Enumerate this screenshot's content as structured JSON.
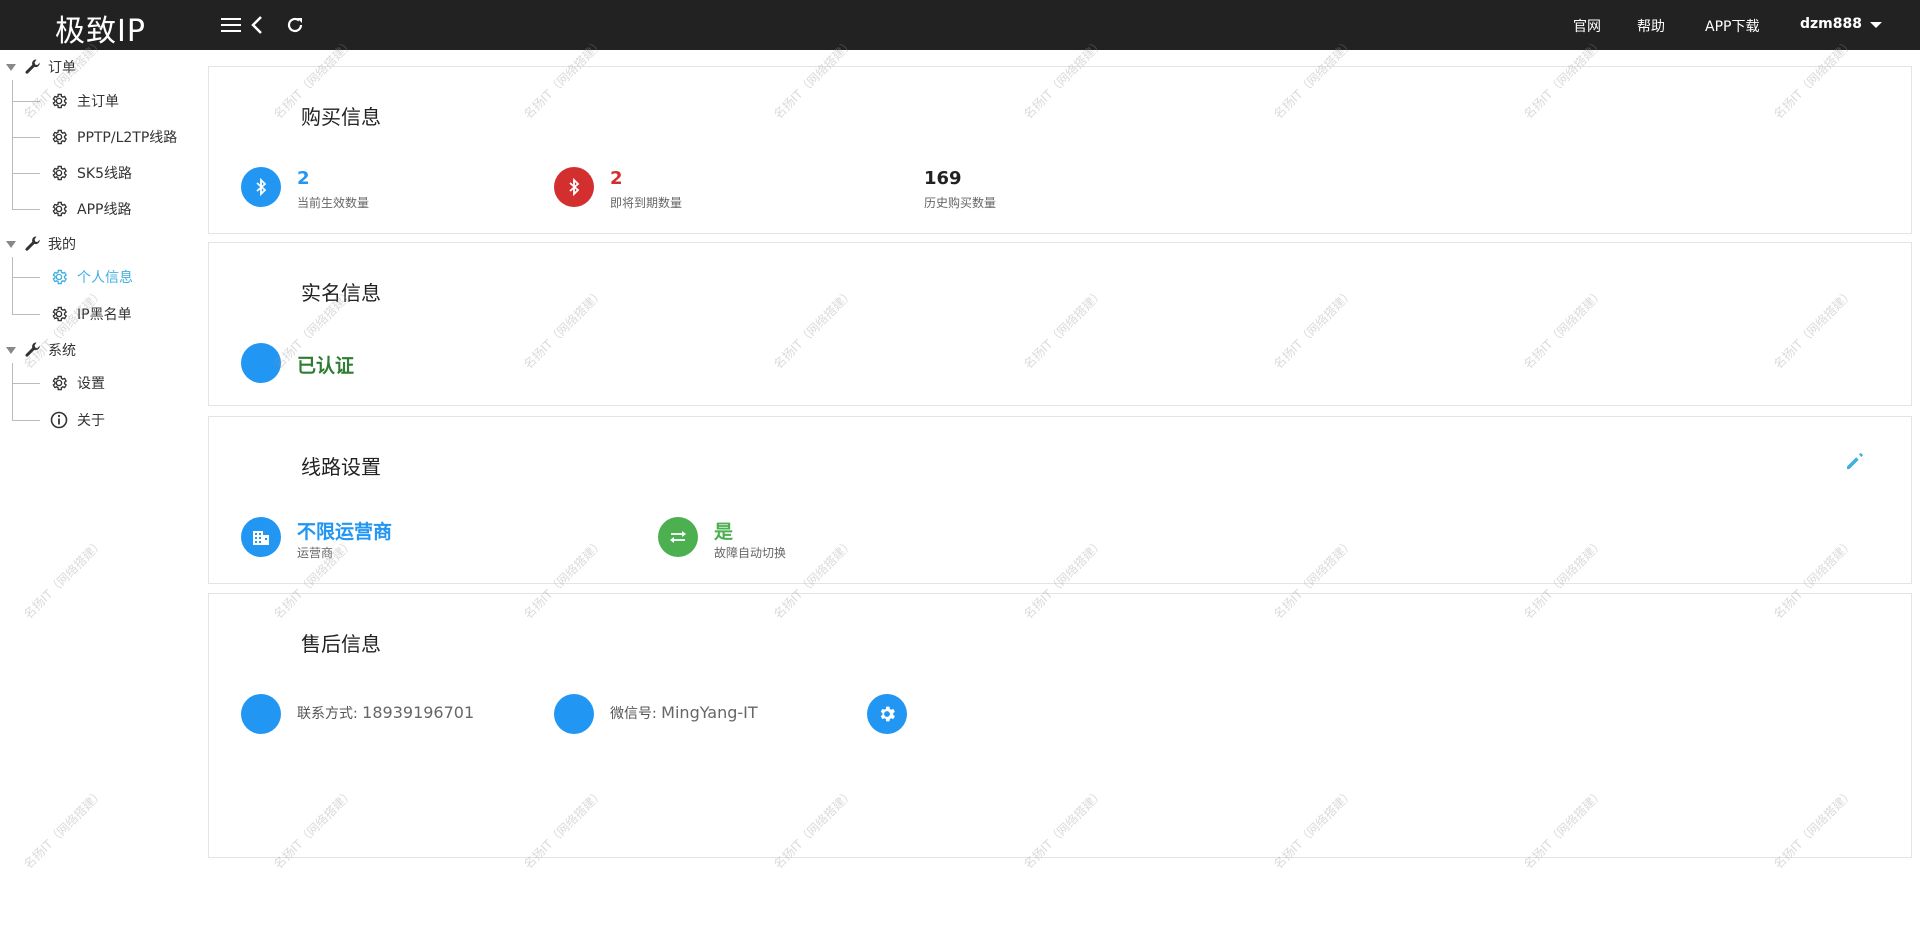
{
  "app": {
    "brand": "极致IP"
  },
  "topbar": {
    "nav": [
      "官网",
      "帮助",
      "APP下载"
    ],
    "user": "dzm888"
  },
  "sidebar": {
    "groups": [
      {
        "label": "订单",
        "items": [
          "主订单",
          "PPTP/L2TP线路",
          "SK5线路",
          "APP线路"
        ]
      },
      {
        "label": "我的",
        "items": [
          "个人信息",
          "IP黑名单"
        ]
      },
      {
        "label": "系统",
        "items": [
          "设置",
          "关于"
        ]
      }
    ],
    "active_item": "个人信息"
  },
  "purchase": {
    "title": "购买信息",
    "active_count": "2",
    "active_label": "当前生效数量",
    "expiring_count": "2",
    "expiring_label": "即将到期数量",
    "history_count": "169",
    "history_label": "历史购买数量"
  },
  "realname": {
    "title": "实名信息",
    "status": "已认证"
  },
  "line": {
    "title": "线路设置",
    "carrier_value": "不限运营商",
    "carrier_label": "运营商",
    "failover_value": "是",
    "failover_label": "故障自动切换"
  },
  "aftersales": {
    "title": "售后信息",
    "phone_label": "联系方式: ",
    "phone": "18939196701",
    "wechat_label": "微信号: ",
    "wechat": "MingYang-IT"
  },
  "watermark": "名扬IT（网络搭建）",
  "colors": {
    "blue": "#2196f3",
    "red": "#d32f2f",
    "green": "#4caf50",
    "dark_green": "#2e7d32",
    "active": "#3fb0e0",
    "topbar": "#222222"
  }
}
